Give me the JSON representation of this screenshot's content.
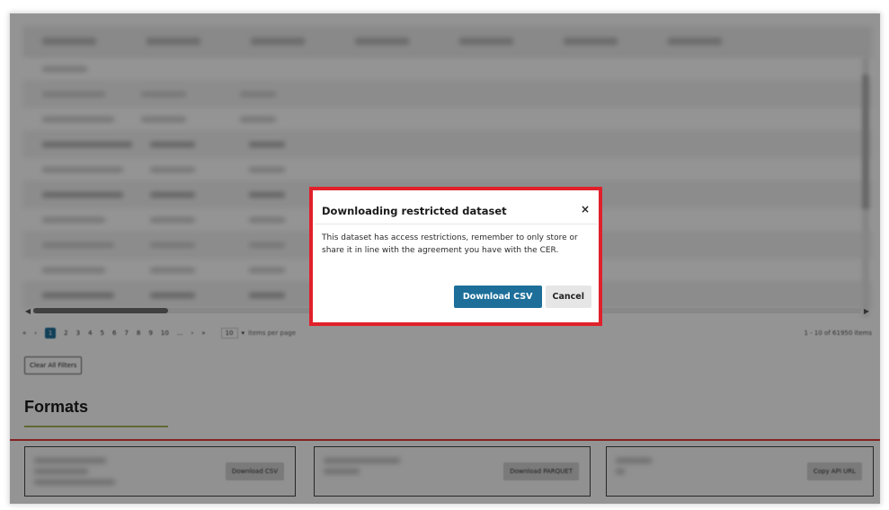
{
  "pagination": {
    "first": "«",
    "prev": "‹",
    "pages": [
      "1",
      "2",
      "3",
      "4",
      "5",
      "6",
      "7",
      "8",
      "9",
      "10",
      "..."
    ],
    "next": "›",
    "last": "»",
    "per_page_value": "10",
    "per_page_caret": "▾",
    "per_page_label": "items per page",
    "count_text": "1 - 10 of 61950 items"
  },
  "scroll": {
    "left_arrow": "◀",
    "right_arrow": "▶"
  },
  "clear_filters_label": "Clear All Filters",
  "formats": {
    "title": "Formats",
    "cards": [
      {
        "button_label": "Download CSV"
      },
      {
        "button_label": "Download PARQUET"
      },
      {
        "button_label": "Copy API URL"
      }
    ]
  },
  "modal": {
    "title": "Downloading restricted dataset",
    "close_glyph": "×",
    "body": "This dataset has access restrictions, remember to only store or share it in line with the agreement you have with the CER.",
    "download_label": "Download CSV",
    "cancel_label": "Cancel"
  },
  "colors": {
    "primary": "#1d6f9a",
    "highlight": "#e0202a",
    "accent_underline": "#a4b65a"
  }
}
